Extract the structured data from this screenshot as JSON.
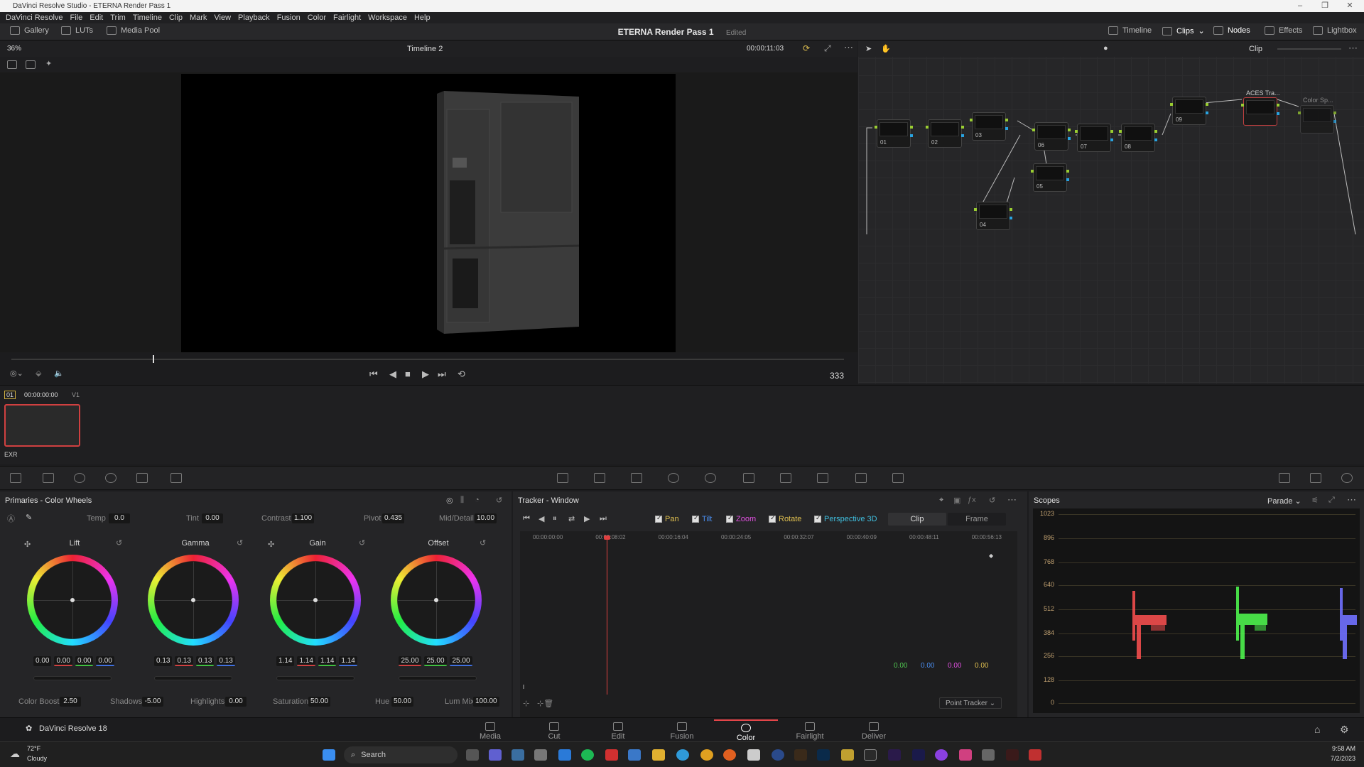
{
  "window": {
    "title": "DaVinci Resolve Studio - ETERNA Render Pass 1"
  },
  "menu": [
    "DaVinci Resolve",
    "File",
    "Edit",
    "Trim",
    "Timeline",
    "Clip",
    "Mark",
    "View",
    "Playback",
    "Fusion",
    "Color",
    "Fairlight",
    "Workspace",
    "Help"
  ],
  "toolbar": {
    "gallery": "Gallery",
    "luts": "LUTs",
    "media_pool": "Media Pool",
    "project_title": "ETERNA Render Pass 1",
    "edited": "Edited",
    "timeline": "Timeline",
    "clips": "Clips",
    "nodes": "Nodes",
    "effects": "Effects",
    "lightbox": "Lightbox"
  },
  "viewer": {
    "zoom": "36%",
    "timeline_name": "Timeline 2",
    "timecode": "00:00:11:03",
    "frame_count": "333"
  },
  "node_editor": {
    "mode": "Clip",
    "nodes": [
      {
        "label": "01"
      },
      {
        "label": "02"
      },
      {
        "label": "03"
      },
      {
        "label": "04"
      },
      {
        "label": "05"
      },
      {
        "label": "06"
      },
      {
        "label": "07"
      },
      {
        "label": "08"
      },
      {
        "label": "09"
      },
      {
        "label": "ACES Tra..."
      },
      {
        "label": "Color Sp..."
      }
    ]
  },
  "clips": {
    "index": "01",
    "timecode": "00:00:00:00",
    "track": "V1",
    "format": "EXR"
  },
  "color_wheels": {
    "title": "Primaries - Color Wheels",
    "temp_label": "Temp",
    "temp": "0.0",
    "tint_label": "Tint",
    "tint": "0.00",
    "contrast_label": "Contrast",
    "contrast": "1.100",
    "pivot_label": "Pivot",
    "pivot": "0.435",
    "mid_label": "Mid/Detail",
    "mid": "10.00",
    "wheels": [
      {
        "name": "Lift",
        "values": [
          "0.00",
          "0.00",
          "0.00",
          "0.00"
        ]
      },
      {
        "name": "Gamma",
        "values": [
          "0.13",
          "0.13",
          "0.13",
          "0.13"
        ]
      },
      {
        "name": "Gain",
        "values": [
          "1.14",
          "1.14",
          "1.14",
          "1.14"
        ]
      },
      {
        "name": "Offset",
        "values": [
          "25.00",
          "25.00",
          "25.00"
        ]
      }
    ],
    "color_boost_label": "Color Boost",
    "color_boost": "2.50",
    "shadows_label": "Shadows",
    "shadows": "-5.00",
    "highlights_label": "Highlights",
    "highlights": "0.00",
    "saturation_label": "Saturation",
    "saturation": "50.00",
    "hue_label": "Hue",
    "hue": "50.00",
    "lum_mix_label": "Lum Mix",
    "lum_mix": "100.00"
  },
  "tracker": {
    "title": "Tracker - Window",
    "checks": [
      "Pan",
      "Tilt",
      "Zoom",
      "Rotate",
      "Perspective 3D"
    ],
    "check_colors": [
      "#e0c050",
      "#4a8ef0",
      "#e050e0",
      "#e0c050",
      "#40c0e0"
    ],
    "clip_tab": "Clip",
    "frame_tab": "Frame",
    "ruler": [
      "00:00:00:00",
      "00:00:08:02",
      "00:00:16:04",
      "00:00:24:05",
      "00:00:32:07",
      "00:00:40:09",
      "00:00:48:11",
      "00:00:56:13"
    ],
    "readouts": [
      "0.00",
      "0.00",
      "0.00",
      "0.00"
    ],
    "readout_colors": [
      "#50c850",
      "#4a8ef0",
      "#e050e0",
      "#e0c050"
    ],
    "mode": "Point Tracker"
  },
  "scopes": {
    "title": "Scopes",
    "mode": "Parade",
    "scale": [
      "1023",
      "896",
      "768",
      "640",
      "512",
      "384",
      "256",
      "128",
      "0"
    ]
  },
  "pages": {
    "app": "DaVinci Resolve 18",
    "items": [
      "Media",
      "Cut",
      "Edit",
      "Fusion",
      "Color",
      "Fairlight",
      "Deliver"
    ]
  },
  "taskbar": {
    "weather_temp": "72°F",
    "weather_desc": "Cloudy",
    "search": "Search",
    "time": "9:58 AM",
    "date": "7/2/2023"
  }
}
